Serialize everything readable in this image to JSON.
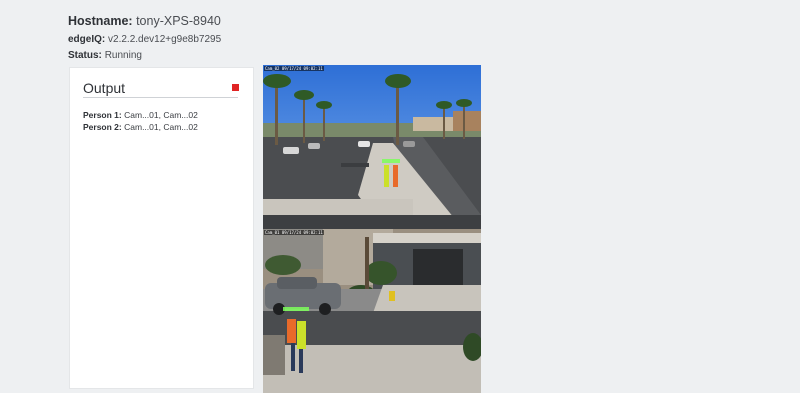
{
  "header": {
    "hostname_label": "Hostname:",
    "hostname_value": "tony-XPS-8940",
    "version_label": "edgeIQ:",
    "version_value": "v2.2.2.dev12+g9e8b7295",
    "status_label": "Status:",
    "status_value": "Running"
  },
  "output": {
    "title": "Output",
    "stop_color": "#e02424",
    "items": [
      {
        "label": "Person 1:",
        "value": "Cam...01, Cam...02"
      },
      {
        "label": "Person 2:",
        "value": "Cam...01, Cam...02"
      }
    ]
  },
  "video": {
    "top_stamp": "Cam_02 09/17/24 09:02:11",
    "bottom_stamp": "Cam_01 09/17/24 09:02:11",
    "detection_box_color": "#7cff5a"
  }
}
